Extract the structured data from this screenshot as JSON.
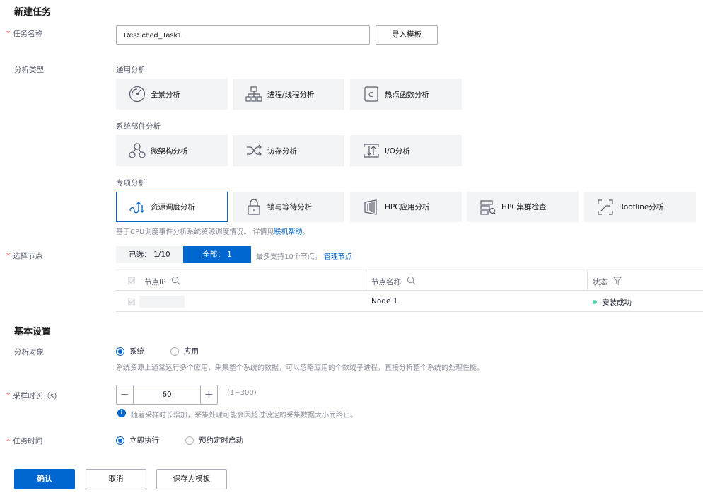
{
  "title": "新建任务",
  "task_name": {
    "label": "任务名称",
    "value": "ResSched_Task1",
    "import_button": "导入模板"
  },
  "analysis_type": {
    "label": "分析类型",
    "groups": [
      {
        "title": "通用分析",
        "items": [
          {
            "label": "全景分析",
            "icon": "gauge-icon"
          },
          {
            "label": "进程/线程分析",
            "icon": "hierarchy-icon"
          },
          {
            "label": "热点函数分析",
            "icon": "c-function-icon"
          }
        ]
      },
      {
        "title": "系统部件分析",
        "items": [
          {
            "label": "微架构分析",
            "icon": "microarch-icon"
          },
          {
            "label": "访存分析",
            "icon": "shuffle-icon"
          },
          {
            "label": "I/O分析",
            "icon": "io-icon"
          }
        ]
      },
      {
        "title": "专项分析",
        "items": [
          {
            "label": "资源调度分析",
            "icon": "resource-schedule-icon",
            "selected": true
          },
          {
            "label": "锁与等待分析",
            "icon": "lock-icon"
          },
          {
            "label": "HPC应用分析",
            "icon": "hpc-app-icon"
          },
          {
            "label": "HPC集群检查",
            "icon": "hpc-cluster-icon"
          },
          {
            "label": "Roofline分析",
            "icon": "roofline-icon"
          }
        ]
      }
    ],
    "description": "基于CPU调度事件分析系统资源调度情况。 详情见",
    "help_link": "联机帮助",
    "description_end": "。"
  },
  "nodes": {
    "label": "选择节点",
    "selected_tab": "已选： 1/10",
    "all_tab": "全部：  1",
    "limit_text": "最多支持10个节点。",
    "manage_link": "管理节点",
    "columns": [
      "节点IP",
      "节点名称",
      "状态"
    ],
    "rows": [
      {
        "ip": "",
        "name": "Node 1",
        "status": "安装成功"
      }
    ],
    "status_color": "#50d4ab"
  },
  "basic": {
    "title": "基本设置",
    "object_label": "分析对象",
    "object_options": [
      "系统",
      "应用"
    ],
    "object_hint": "系统资源上通常运行多个应用，采集整个系统的数据，可以忽略应用的个数或子进程，直接分析整个系统的处理性能。",
    "duration_label": "采样时长（s)",
    "duration_value": "60",
    "duration_range": "(1~300)",
    "duration_hint": "随着采样时长增加，采集处理可能会因超过设定的采集数据大小而终止。",
    "time_label": "任务时间",
    "time_options": [
      "立即执行",
      "预约定时启动"
    ]
  },
  "actions": {
    "confirm": "确认",
    "cancel": "取消",
    "save_template": "保存为模板"
  },
  "colors": {
    "primary": "#0067d1",
    "required": "#e54545",
    "card_bg": "#f3f4f6"
  }
}
